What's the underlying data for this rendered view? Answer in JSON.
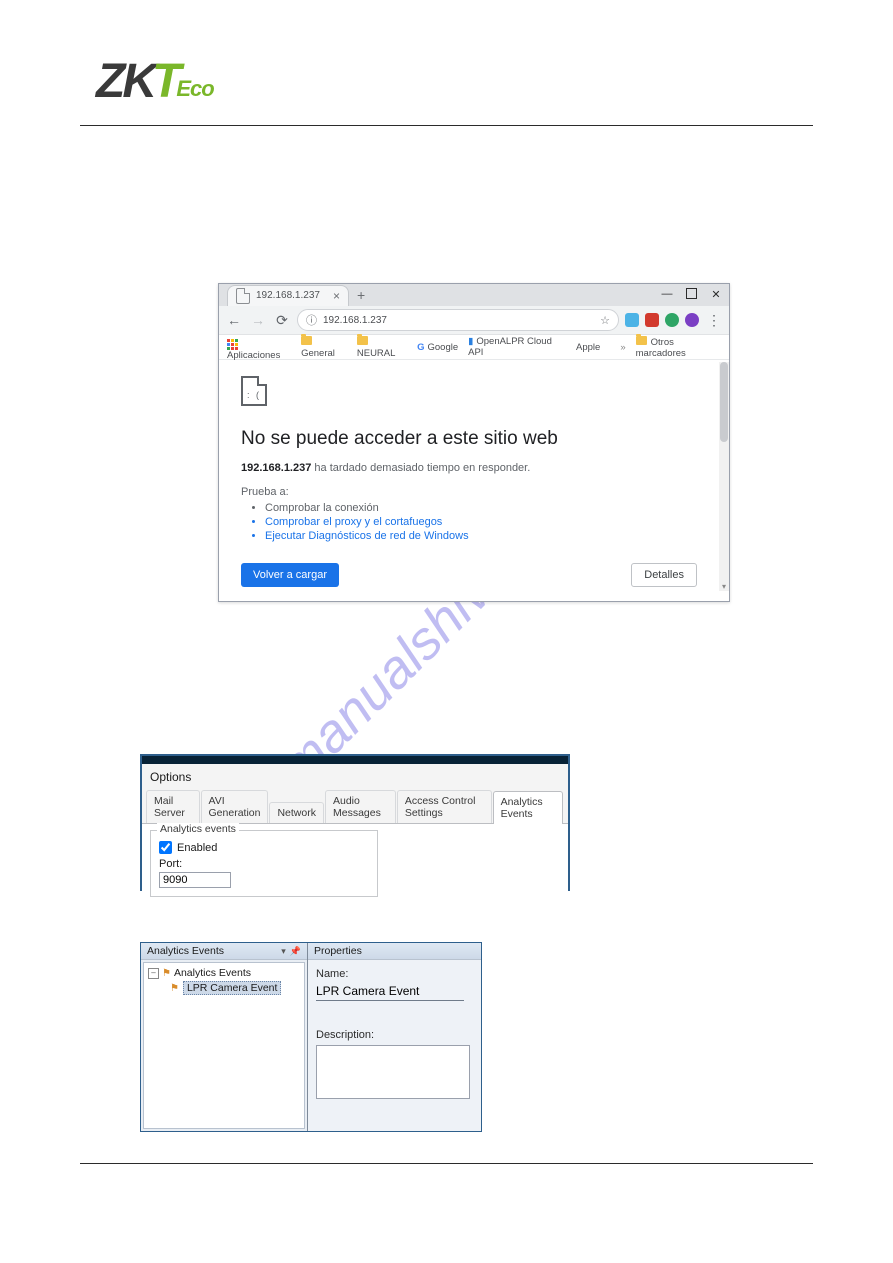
{
  "logo": {
    "p1": "ZK",
    "p2": "T",
    "p3": "Eco"
  },
  "watermark": "manualshive.com",
  "chrome": {
    "tab_title": "192.168.1.237",
    "url": "192.168.1.237",
    "bookmarks": {
      "apps": "Aplicaciones",
      "items": [
        "General",
        "NEURAL"
      ],
      "google": "Google",
      "openalpr": "OpenALPR Cloud API",
      "apple": "Apple",
      "more": "Otros marcadores"
    },
    "error": {
      "title": "No se puede acceder a este sitio web",
      "host": "192.168.1.237",
      "sub_rest": " ha tardado demasiado tiempo en responder.",
      "try_label": "Prueba a:",
      "s1": "Comprobar la conexión",
      "s2": "Comprobar el proxy y el cortafuegos",
      "s3": "Ejecutar Diagnósticos de red de Windows",
      "reload": "Volver a cargar",
      "details": "Detalles"
    }
  },
  "options": {
    "title": "Options",
    "tabs": [
      "Mail Server",
      "AVI Generation",
      "Network",
      "Audio Messages",
      "Access Control Settings",
      "Analytics Events"
    ],
    "active_tab": 5,
    "group_legend": "Analytics events",
    "enabled_label": "Enabled",
    "enabled": true,
    "port_label": "Port:",
    "port_value": "9090"
  },
  "ae_panel": {
    "left_title": "Analytics Events",
    "root": "Analytics Events",
    "child": "LPR Camera Event",
    "right_title": "Properties",
    "name_label": "Name:",
    "name_value": "LPR Camera Event",
    "desc_label": "Description:",
    "desc_value": ""
  }
}
